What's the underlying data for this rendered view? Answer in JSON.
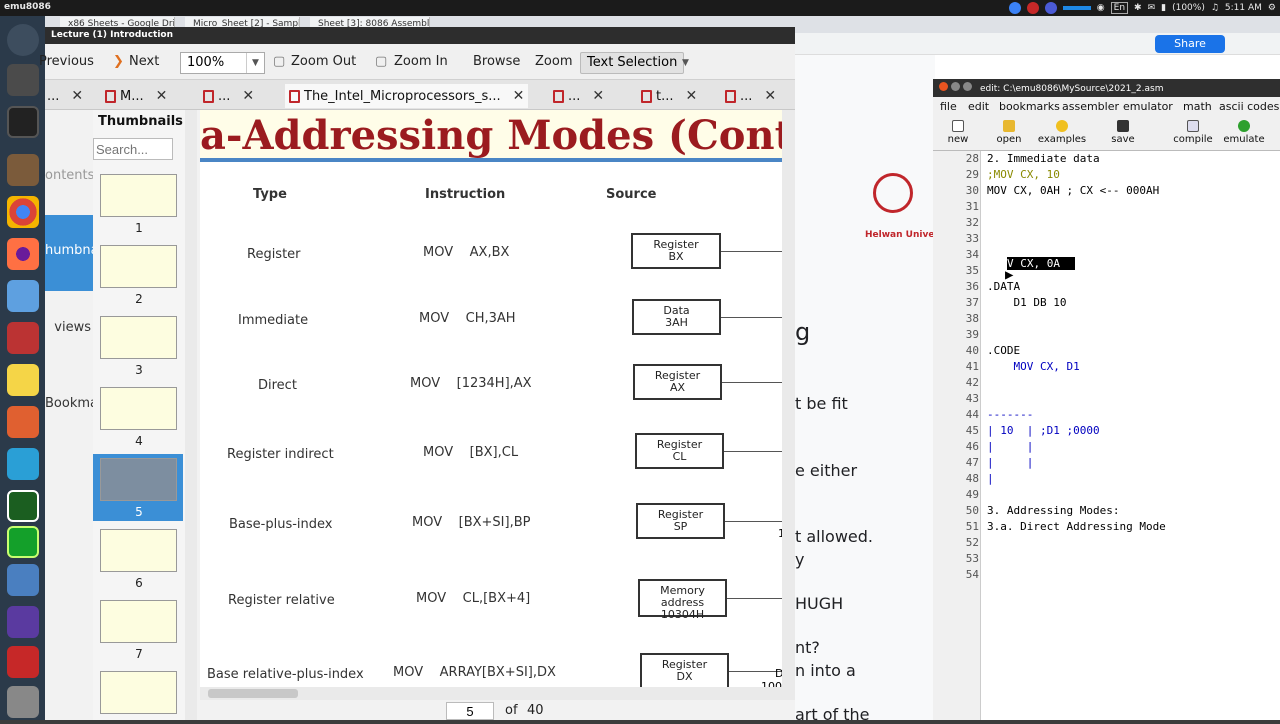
{
  "topbar": {
    "app": "emu8086",
    "battery": "(100%)",
    "clock": "5:11 AM",
    "lang": "En"
  },
  "chrome": {
    "tabs": [
      "x86 Sheets - Google Drive",
      "Micro_Sheet [2] - Sample",
      "Sheet [3]: 8086 Assembly"
    ],
    "share": "Share"
  },
  "bgdoc": {
    "fragments": [
      "g",
      "t be fit",
      "e either",
      "t allowed.",
      "y",
      "HUGH",
      "nt?",
      "n into a",
      "art of the"
    ],
    "logo_text": "Helwan Universit"
  },
  "pdf": {
    "title": "Lecture (1)  Introduction",
    "toolbar": {
      "previous": "Previous",
      "next": "Next",
      "zoom": "100%",
      "zoom_out": "Zoom Out",
      "zoom_in": "Zoom In",
      "browse": "Browse",
      "zoom_label": "Zoom",
      "text_selection": "Text Selection"
    },
    "tabs": [
      "...",
      "M...",
      "...",
      "The_Intel_Microprocessors_s...",
      "...",
      "t...",
      "..."
    ],
    "sidebar": {
      "contents": "ontents",
      "thumbnails": "humbnails",
      "views": "views",
      "bookmarks": "Bookmarks"
    },
    "thumbs": {
      "heading": "Thumbnails",
      "search_placeholder": "Search...",
      "pages": [
        "1",
        "2",
        "3",
        "4",
        "5",
        "6",
        "7"
      ],
      "selected": "5"
    },
    "slide": {
      "title": "a-Addressing Modes (Cont’d)",
      "headers": {
        "type": "Type",
        "instruction": "Instruction",
        "source": "Source"
      },
      "rows": [
        {
          "type": "Register",
          "instr": "MOV    AX,BX",
          "source": "Register\nBX"
        },
        {
          "type": "Immediate",
          "instr": "MOV    CH,3AH",
          "source": "Data\n3AH"
        },
        {
          "type": "Direct",
          "instr": "MOV    [1234H],AX",
          "source": "Register\nAX"
        },
        {
          "type": "Register indirect",
          "instr": "MOV    [BX],CL",
          "source": "Register\nCL"
        },
        {
          "type": "Base-plus-index",
          "instr": "MOV    [BX+SI],BP",
          "source": "Register\nSP"
        },
        {
          "type": "Register relative",
          "instr": "MOV    CL,[BX+4]",
          "source": "Memory\naddress\n10304H"
        },
        {
          "type": "Base relative-plus-index",
          "instr": "MOV    ARRAY[BX+SI],DX",
          "source": "Register\nDX"
        }
      ],
      "edge": {
        "r5": "1",
        "r7a": "D",
        "r7b": "100"
      }
    },
    "pagebar": {
      "current": "5",
      "of": "of",
      "total": "40"
    }
  },
  "emu": {
    "title": "edit: C:\\emu8086\\MySource\\2021_2.asm",
    "menu": [
      "file",
      "edit",
      "bookmarks",
      "assembler",
      "emulator",
      "math",
      "ascii codes"
    ],
    "toolbar": [
      "new",
      "open",
      "examples",
      "save",
      "compile",
      "emulate"
    ],
    "lines": [
      {
        "n": "28",
        "t": "2. Immediate data",
        "c": "#000"
      },
      {
        "n": "29",
        "t": ";MOV CX, 10",
        "c": "#8a8a00"
      },
      {
        "n": "30",
        "t": "MOV CX, 0AH ; CX <-- 000AH",
        "c": "#000"
      },
      {
        "n": "31",
        "t": "",
        "c": "#000"
      },
      {
        "n": "32",
        "t": "",
        "c": "#000"
      },
      {
        "n": "33",
        "t": "",
        "c": "#000"
      },
      {
        "n": "34",
        "t": "",
        "c": "#000"
      },
      {
        "n": "35",
        "t": "",
        "c": "#000"
      },
      {
        "n": "36",
        "t": ".DATA",
        "c": "#000"
      },
      {
        "n": "37",
        "t": "    D1 DB 10",
        "c": "#000"
      },
      {
        "n": "38",
        "t": "",
        "c": "#000"
      },
      {
        "n": "39",
        "t": "",
        "c": "#000"
      },
      {
        "n": "40",
        "t": ".CODE",
        "c": "#000"
      },
      {
        "n": "41",
        "t": "    MOV CX, D1",
        "c": "#0000c0"
      },
      {
        "n": "42",
        "t": "",
        "c": "#000"
      },
      {
        "n": "43",
        "t": "",
        "c": "#000"
      },
      {
        "n": "44",
        "t": "-------",
        "c": "#0000c0"
      },
      {
        "n": "45",
        "t": "| 10  | ;D1 ;0000",
        "c": "#0000c0"
      },
      {
        "n": "46",
        "t": "|     |",
        "c": "#0000c0"
      },
      {
        "n": "47",
        "t": "|     |",
        "c": "#0000c0"
      },
      {
        "n": "48",
        "t": "|",
        "c": "#0000c0"
      },
      {
        "n": "49",
        "t": "",
        "c": "#000"
      },
      {
        "n": "50",
        "t": "3. Addressing Modes:",
        "c": "#000"
      },
      {
        "n": "51",
        "t": "3.a. Direct Addressing Mode",
        "c": "#000"
      },
      {
        "n": "52",
        "t": "",
        "c": "#000"
      },
      {
        "n": "53",
        "t": "",
        "c": "#000"
      },
      {
        "n": "54",
        "t": "",
        "c": "#000"
      }
    ]
  }
}
